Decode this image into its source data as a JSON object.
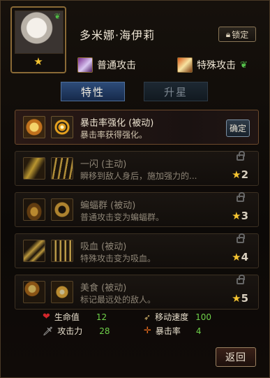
{
  "hero": {
    "name": "多米娜·海伊莉",
    "stars": "★",
    "lock_label": "锁定"
  },
  "attacks": {
    "normal": "普通攻击",
    "special": "特殊攻击"
  },
  "tabs": [
    {
      "label": "特性",
      "active": true
    },
    {
      "label": "升星",
      "active": false
    }
  ],
  "skills": [
    {
      "name": "暴击率强化 (被动)",
      "desc": "暴击率获得强化。",
      "action": "确定",
      "locked": false
    },
    {
      "name": "一闪 (主动)",
      "desc": "瞬移到敌人身后，施加强力的...",
      "requirement": "2",
      "locked": true
    },
    {
      "name": "蝙蝠群 (被动)",
      "desc": "普通攻击变为蝙蝠群。",
      "requirement": "3",
      "locked": true
    },
    {
      "name": "吸血 (被动)",
      "desc": "特殊攻击变为吸血。",
      "requirement": "4",
      "locked": true
    },
    {
      "name": "美食 (被动)",
      "desc": "标记最远处的敌人。",
      "requirement": "5",
      "locked": true
    }
  ],
  "stats": [
    {
      "label": "生命值",
      "value": "12",
      "icon": "heart-icon"
    },
    {
      "label": "移动速度",
      "value": "100",
      "icon": "wing-boot-icon"
    },
    {
      "label": "攻击力",
      "value": "28",
      "icon": "sword-icon"
    },
    {
      "label": "暴击率",
      "value": "4",
      "icon": "crosshair-icon"
    }
  ],
  "back_label": "返回",
  "colors": {
    "star": "#f5c431",
    "stat_value": "#6fd04a",
    "tab_active": "#2d4c79"
  }
}
